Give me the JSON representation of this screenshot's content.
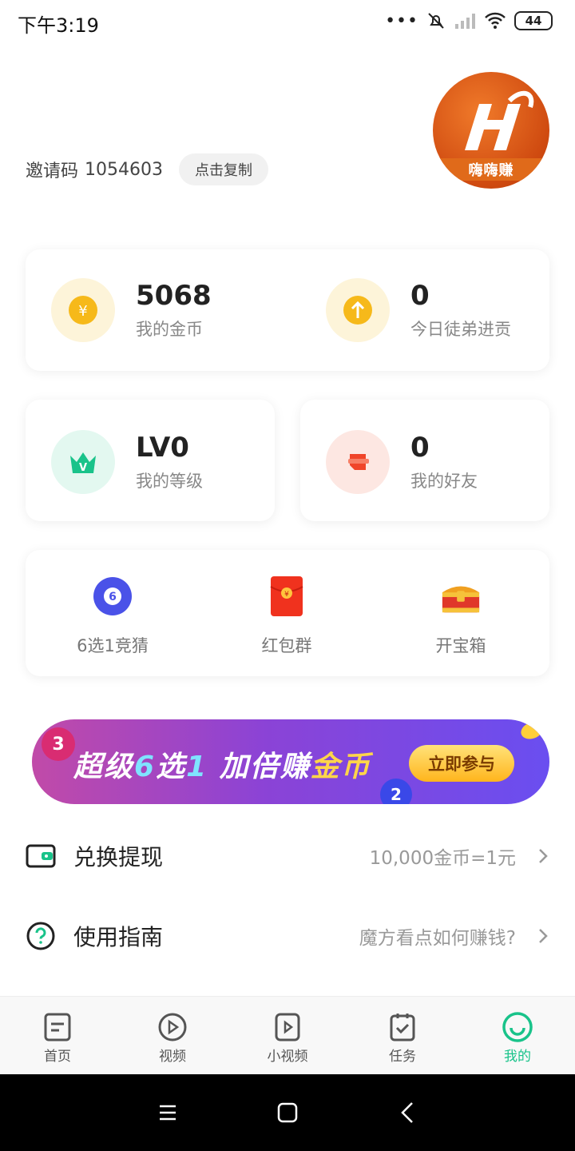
{
  "status_bar": {
    "time": "下午3:19",
    "battery": "44"
  },
  "header": {
    "invite_label": "邀请码",
    "invite_code": "1054603",
    "copy_button": "点击复制",
    "avatar_text": "嗨嗨赚"
  },
  "stats": {
    "coins": {
      "value": "5068",
      "label": "我的金币"
    },
    "disciple": {
      "value": "0",
      "label": "今日徒弟进贡"
    },
    "level": {
      "value": "LV0",
      "label": "我的等级"
    },
    "friends": {
      "value": "0",
      "label": "我的好友"
    }
  },
  "quick_actions": [
    {
      "label": "6选1竞猜",
      "icon": "lottery-ball-icon",
      "badge": "6"
    },
    {
      "label": "红包群",
      "icon": "red-envelope-icon"
    },
    {
      "label": "开宝箱",
      "icon": "treasure-chest-icon"
    }
  ],
  "banner": {
    "text_part1": "超级",
    "text_em1": "6",
    "text_part2": "选",
    "text_em2": "1",
    "text_part3": " 加倍赚",
    "text_em3": "金币",
    "button": "立即参与",
    "ball_left": "3",
    "ball_right": "2"
  },
  "list": {
    "exchange": {
      "title": "兑换提现",
      "value": "10,000金币=1元"
    },
    "guide": {
      "title": "使用指南",
      "value": "魔方看点如何赚钱?"
    }
  },
  "bottom_nav": [
    {
      "label": "首页",
      "icon": "home-icon"
    },
    {
      "label": "视频",
      "icon": "video-icon"
    },
    {
      "label": "小视频",
      "icon": "short-video-icon"
    },
    {
      "label": "任务",
      "icon": "task-icon"
    },
    {
      "label": "我的",
      "icon": "profile-icon",
      "active": true
    }
  ],
  "colors": {
    "accent": "#19c38a",
    "coin": "#f6b91a",
    "red": "#f0452a"
  }
}
